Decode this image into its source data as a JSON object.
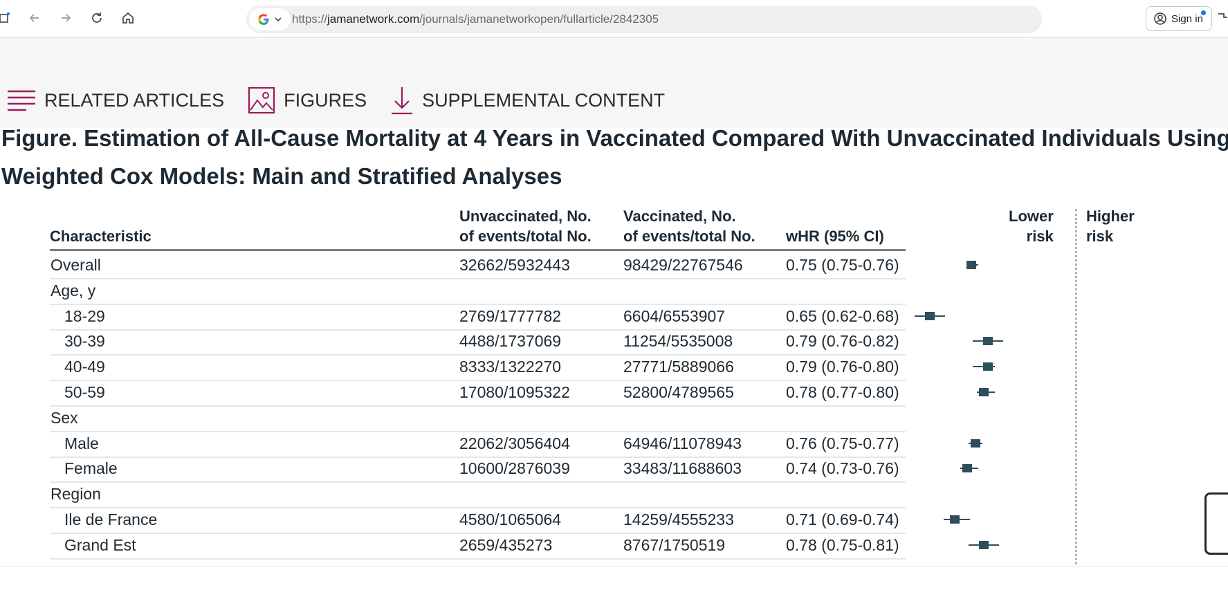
{
  "browser": {
    "url_prefix": "https://",
    "url_host": "jamanetwork.com",
    "url_path": "/journals/jamanetworkopen/fullarticle/2842305",
    "signin_label": "Sign in",
    "icons": [
      "new-tab-icon",
      "back-icon",
      "forward-icon",
      "reload-icon",
      "home-icon",
      "google-icon",
      "chevron-down-icon",
      "account-icon",
      "extensions-icon"
    ]
  },
  "article_nav": {
    "items": [
      {
        "label": "RELATED ARTICLES",
        "icon": "menu-lines-icon"
      },
      {
        "label": "FIGURES",
        "icon": "image-icon"
      },
      {
        "label": "SUPPLEMENTAL CONTENT",
        "icon": "download-arrow-icon"
      }
    ],
    "accent_color": "#9b1b5a"
  },
  "figure": {
    "title_line1": "Figure.  Estimation of All-Cause Mortality at 4 Years in Vaccinated Compared With Unvaccinated Individuals Using",
    "title_line2": "Weighted Cox Models: Main and Stratified Analyses"
  },
  "table": {
    "headers": {
      "characteristic": "Characteristic",
      "unvacc_line1": "Unvaccinated, No.",
      "unvacc_line2": "of events/total No.",
      "vacc_line1": "Vaccinated, No.",
      "vacc_line2": "of events/total No.",
      "whr": "wHR (95% CI)"
    },
    "rows": [
      {
        "label": "Overall",
        "sub": false,
        "unvacc": "32662/5932443",
        "vacc": "98429/22767546",
        "whr": "0.75 (0.75-0.76)"
      },
      {
        "label": "Age, y",
        "sub": false,
        "unvacc": "",
        "vacc": "",
        "whr": ""
      },
      {
        "label": "18-29",
        "sub": true,
        "unvacc": "2769/1777782",
        "vacc": "6604/6553907",
        "whr": "0.65 (0.62-0.68)"
      },
      {
        "label": "30-39",
        "sub": true,
        "unvacc": "4488/1737069",
        "vacc": "11254/5535008",
        "whr": "0.79 (0.76-0.82)"
      },
      {
        "label": "40-49",
        "sub": true,
        "unvacc": "8333/1322270",
        "vacc": "27771/5889066",
        "whr": "0.79 (0.76-0.80)"
      },
      {
        "label": "50-59",
        "sub": true,
        "unvacc": "17080/1095322",
        "vacc": "52800/4789565",
        "whr": "0.78 (0.77-0.80)"
      },
      {
        "label": "Sex",
        "sub": false,
        "unvacc": "",
        "vacc": "",
        "whr": ""
      },
      {
        "label": "Male",
        "sub": true,
        "unvacc": "22062/3056404",
        "vacc": "64946/11078943",
        "whr": "0.76 (0.75-0.77)"
      },
      {
        "label": "Female",
        "sub": true,
        "unvacc": "10600/2876039",
        "vacc": "33483/11688603",
        "whr": "0.74 (0.73-0.76)"
      },
      {
        "label": "Region",
        "sub": false,
        "unvacc": "",
        "vacc": "",
        "whr": ""
      },
      {
        "label": "Ile de France",
        "sub": true,
        "unvacc": "4580/1065064",
        "vacc": "14259/4555233",
        "whr": "0.71 (0.69-0.74)"
      },
      {
        "label": "Grand Est",
        "sub": true,
        "unvacc": "2659/435273",
        "vacc": "8767/1750519",
        "whr": "0.78 (0.75-0.81)"
      }
    ]
  },
  "chart_data": {
    "type": "scatter",
    "x_label_lower": "Lower risk",
    "x_label_higher": "Higher risk",
    "reference_value": 1.0,
    "xlim": [
      0.6,
      1.6
    ],
    "points": [
      {
        "row": "Overall",
        "est": 0.75,
        "lo": 0.75,
        "hi": 0.76
      },
      {
        "row": "18-29",
        "est": 0.65,
        "lo": 0.62,
        "hi": 0.68
      },
      {
        "row": "30-39",
        "est": 0.79,
        "lo": 0.76,
        "hi": 0.82
      },
      {
        "row": "40-49",
        "est": 0.79,
        "lo": 0.76,
        "hi": 0.8
      },
      {
        "row": "50-59",
        "est": 0.78,
        "lo": 0.77,
        "hi": 0.8
      },
      {
        "row": "Male",
        "est": 0.76,
        "lo": 0.75,
        "hi": 0.77
      },
      {
        "row": "Female",
        "est": 0.74,
        "lo": 0.73,
        "hi": 0.76
      },
      {
        "row": "Ile de France",
        "est": 0.71,
        "lo": 0.69,
        "hi": 0.74
      },
      {
        "row": "Grand Est",
        "est": 0.78,
        "lo": 0.75,
        "hi": 0.81
      }
    ],
    "marker_color": "#2e4e5c"
  }
}
